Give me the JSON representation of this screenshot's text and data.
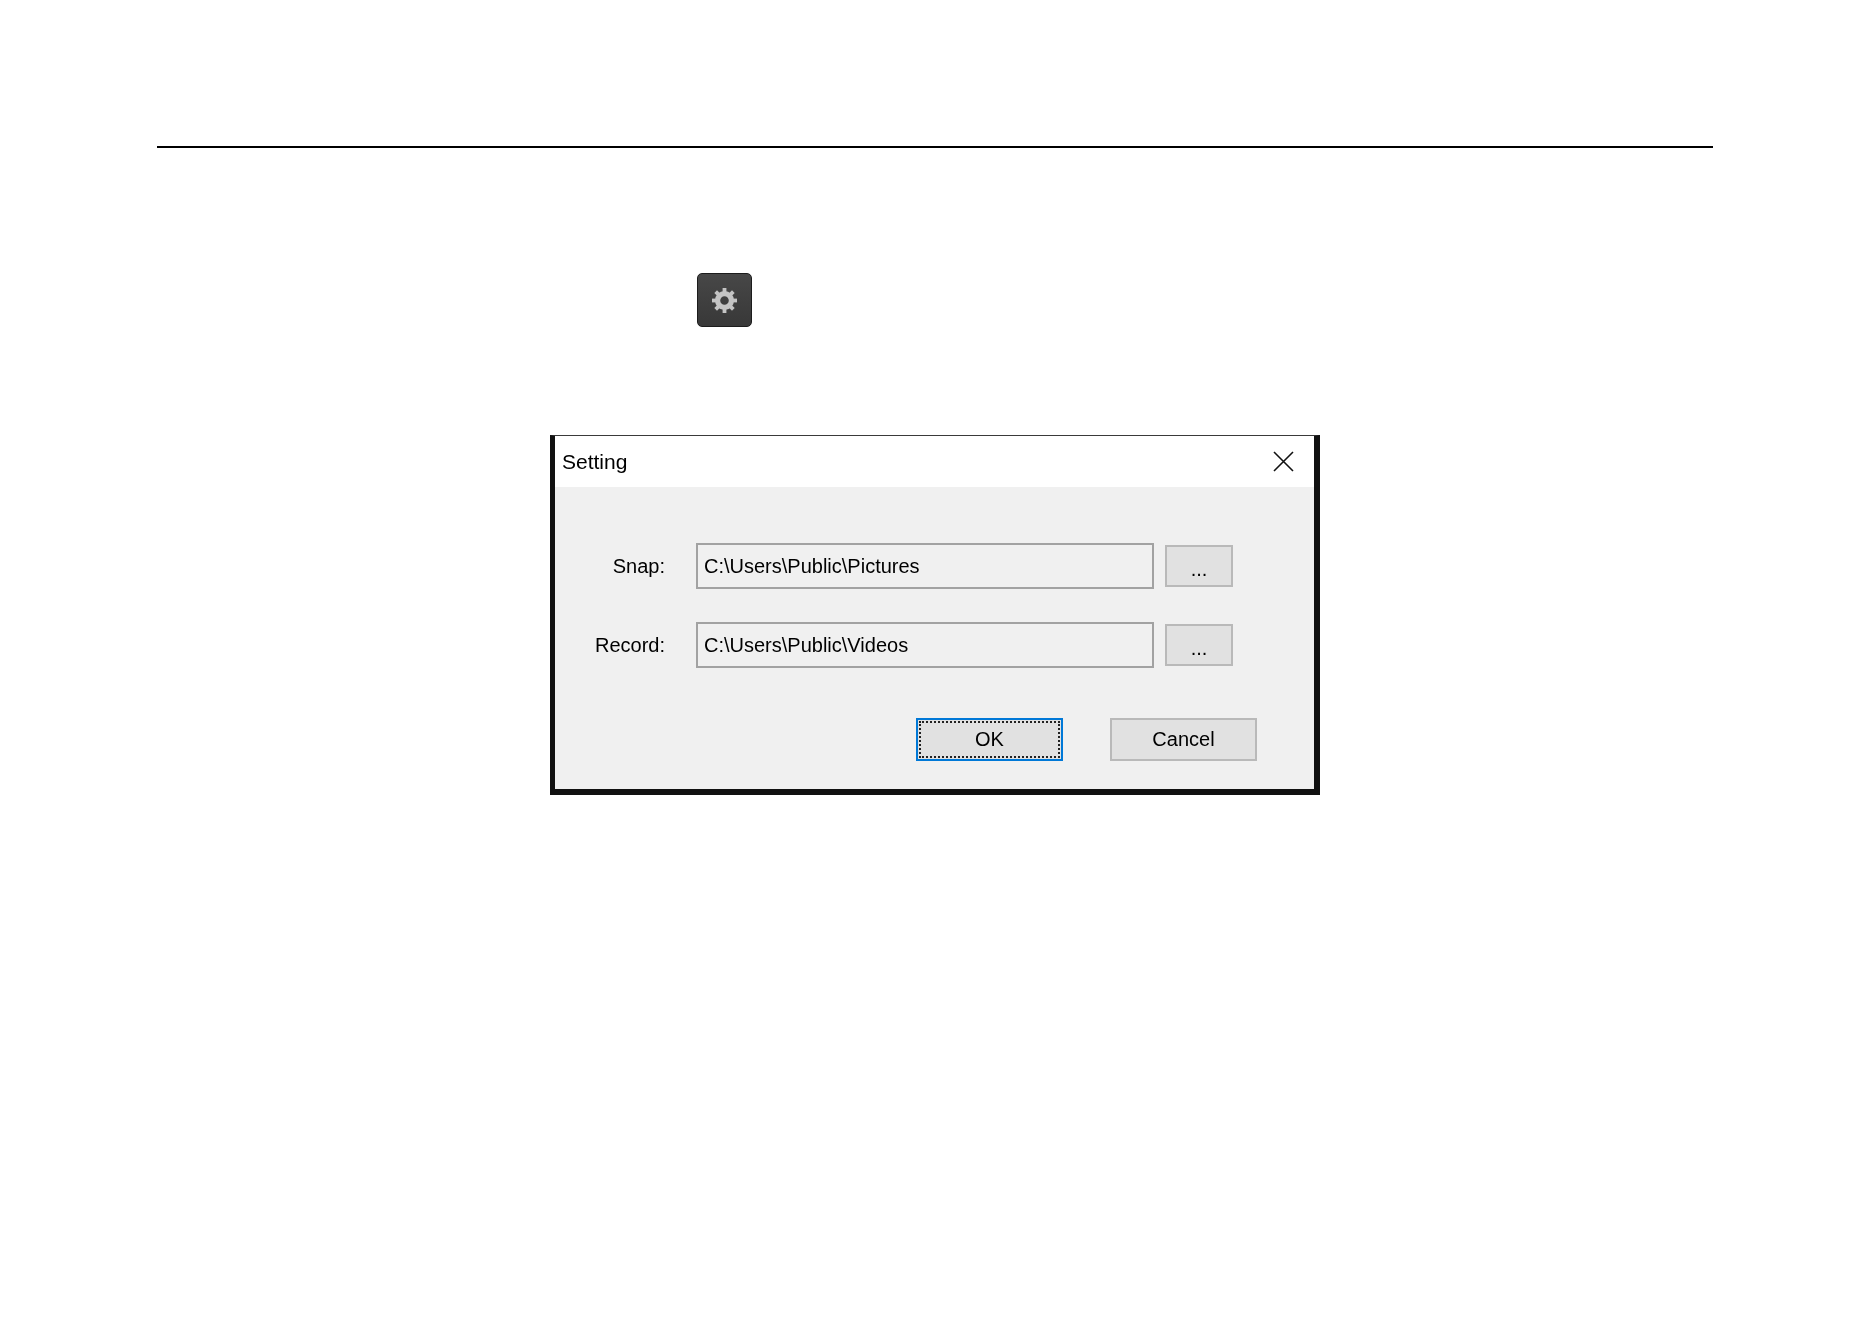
{
  "dialog": {
    "title": "Setting",
    "fields": [
      {
        "label": "Snap:",
        "value": "C:\\Users\\Public\\Pictures",
        "browse_label": "..."
      },
      {
        "label": "Record:",
        "value": "C:\\Users\\Public\\Videos",
        "browse_label": "..."
      }
    ],
    "buttons": [
      {
        "label": "OK",
        "focused": true
      },
      {
        "label": "Cancel",
        "focused": false
      }
    ]
  }
}
